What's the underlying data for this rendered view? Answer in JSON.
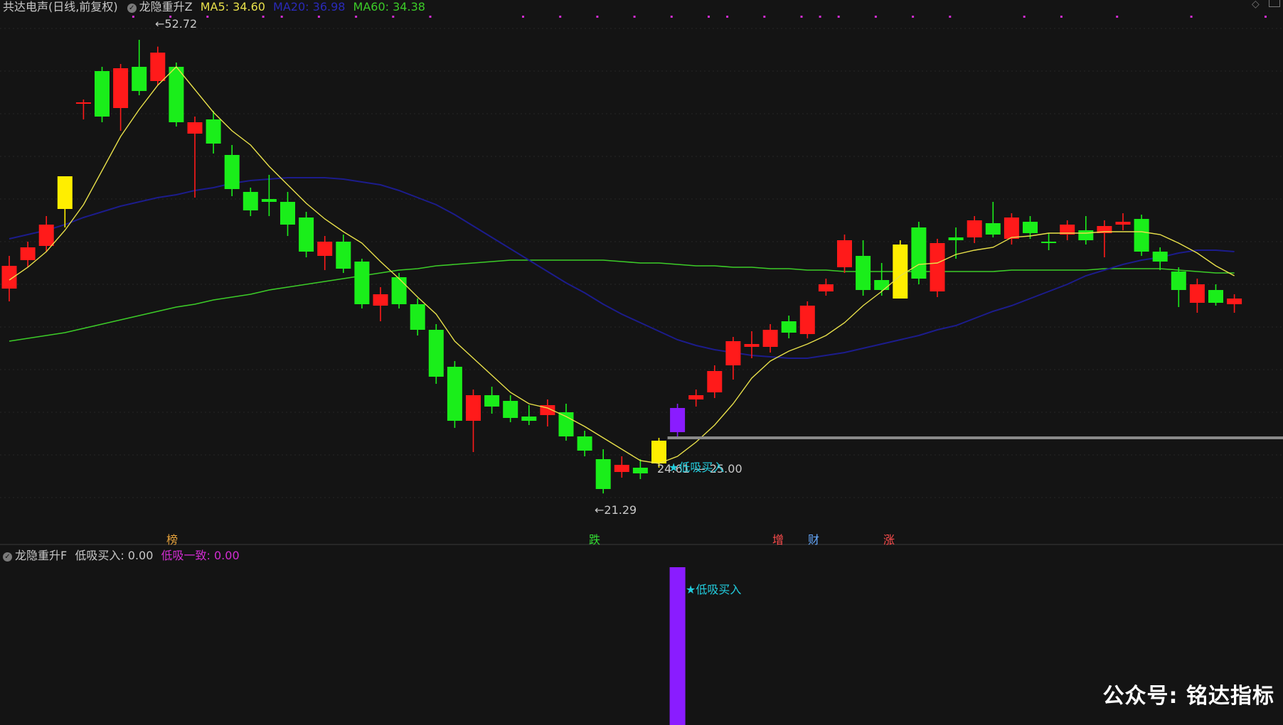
{
  "header": {
    "stock_title": "共达电声(日线,前复权)",
    "indicator_name": "龙隐重升Z",
    "ma5": "MA5: 34.60",
    "ma20": "MA20: 36.98",
    "ma60": "MA60: 34.38"
  },
  "sub_header": {
    "indicator_name": "龙隐重升F",
    "buy_label": "低吸买入: 0.00",
    "consistency_label": "低吸一致: 0.00"
  },
  "annotations": {
    "high_price": "52.72",
    "low_price": "21.29",
    "signal_price_low": "24.61",
    "signal_price_high": "25.00",
    "signal_text": "★低吸买入",
    "sub_signal_text": "★低吸买入"
  },
  "event_markers": [
    {
      "text": "榜",
      "color": "#e6a23c"
    },
    {
      "text": "跌",
      "color": "#33dd33"
    },
    {
      "text": "增",
      "color": "#ff4d4d"
    },
    {
      "text": "财",
      "color": "#66aaff"
    },
    {
      "text": "涨",
      "color": "#ff4d4d"
    }
  ],
  "watermark": "公众号: 铭达指标",
  "colors": {
    "up": "#ff1a1a",
    "down": "#1aee1a",
    "signal_yellow": "#ffee00",
    "signal_purple": "#8a1cff",
    "ma5": "#e8e04a",
    "ma20": "#1c1c8c",
    "ma60": "#3ccc28",
    "magenta": "#d22cd2",
    "cyan": "#22ccdd",
    "text": "#c8c8c8"
  },
  "chart_data": {
    "type": "candlestick",
    "ylim": [
      20,
      54
    ],
    "high_marker": 52.72,
    "low_marker": 21.29,
    "signal_line_level": 25.0,
    "candles": [
      {
        "o": 37.3,
        "c": 35.7,
        "h": 38.0,
        "l": 34.8,
        "k": "up"
      },
      {
        "o": 37.7,
        "c": 38.6,
        "h": 39.0,
        "l": 37.2,
        "k": "up"
      },
      {
        "o": 38.7,
        "c": 40.2,
        "h": 40.8,
        "l": 38.3,
        "k": "up"
      },
      {
        "o": 43.6,
        "c": 41.3,
        "h": 42.6,
        "l": 40.0,
        "k": "yellow"
      },
      {
        "o": 48.8,
        "c": 48.7,
        "h": 49.0,
        "l": 47.6,
        "k": "up"
      },
      {
        "o": 51.0,
        "c": 47.8,
        "h": 51.3,
        "l": 47.4,
        "k": "down"
      },
      {
        "o": 48.4,
        "c": 51.2,
        "h": 51.5,
        "l": 46.8,
        "k": "up"
      },
      {
        "o": 51.3,
        "c": 49.6,
        "h": 53.2,
        "l": 49.3,
        "k": "down"
      },
      {
        "o": 50.3,
        "c": 52.3,
        "h": 52.72,
        "l": 50.0,
        "k": "up"
      },
      {
        "o": 51.3,
        "c": 47.4,
        "h": 51.6,
        "l": 47.1,
        "k": "down"
      },
      {
        "o": 46.6,
        "c": 47.4,
        "h": 47.8,
        "l": 42.1,
        "k": "up"
      },
      {
        "o": 47.6,
        "c": 45.9,
        "h": 48.2,
        "l": 45.2,
        "k": "down"
      },
      {
        "o": 45.1,
        "c": 42.7,
        "h": 45.8,
        "l": 42.2,
        "k": "down"
      },
      {
        "o": 42.5,
        "c": 41.2,
        "h": 42.8,
        "l": 40.8,
        "k": "down"
      },
      {
        "o": 42.0,
        "c": 41.8,
        "h": 43.7,
        "l": 40.8,
        "k": "down"
      },
      {
        "o": 41.8,
        "c": 40.2,
        "h": 42.5,
        "l": 39.4,
        "k": "down"
      },
      {
        "o": 40.7,
        "c": 38.3,
        "h": 41.1,
        "l": 37.9,
        "k": "down"
      },
      {
        "o": 38.0,
        "c": 39.0,
        "h": 39.4,
        "l": 37.0,
        "k": "up"
      },
      {
        "o": 39.0,
        "c": 37.1,
        "h": 39.5,
        "l": 36.8,
        "k": "down"
      },
      {
        "o": 37.6,
        "c": 34.6,
        "h": 37.8,
        "l": 34.3,
        "k": "down"
      },
      {
        "o": 34.5,
        "c": 35.3,
        "h": 35.8,
        "l": 33.4,
        "k": "up"
      },
      {
        "o": 36.5,
        "c": 34.6,
        "h": 36.8,
        "l": 34.3,
        "k": "down"
      },
      {
        "o": 34.6,
        "c": 32.8,
        "h": 35.0,
        "l": 32.4,
        "k": "down"
      },
      {
        "o": 32.8,
        "c": 29.5,
        "h": 33.2,
        "l": 29.0,
        "k": "down"
      },
      {
        "o": 30.2,
        "c": 26.4,
        "h": 30.6,
        "l": 25.9,
        "k": "down"
      },
      {
        "o": 26.4,
        "c": 28.2,
        "h": 28.6,
        "l": 24.2,
        "k": "up"
      },
      {
        "o": 28.2,
        "c": 27.4,
        "h": 28.8,
        "l": 26.9,
        "k": "down"
      },
      {
        "o": 27.8,
        "c": 26.6,
        "h": 28.2,
        "l": 26.3,
        "k": "down"
      },
      {
        "o": 26.7,
        "c": 26.4,
        "h": 27.5,
        "l": 26.1,
        "k": "down"
      },
      {
        "o": 26.8,
        "c": 27.5,
        "h": 27.9,
        "l": 26.0,
        "k": "up"
      },
      {
        "o": 27.0,
        "c": 25.3,
        "h": 27.6,
        "l": 25.0,
        "k": "down"
      },
      {
        "o": 25.3,
        "c": 24.3,
        "h": 25.7,
        "l": 23.9,
        "k": "down"
      },
      {
        "o": 23.7,
        "c": 21.6,
        "h": 24.4,
        "l": 21.29,
        "k": "down"
      },
      {
        "o": 22.8,
        "c": 23.3,
        "h": 23.9,
        "l": 22.4,
        "k": "up"
      },
      {
        "o": 23.1,
        "c": 22.7,
        "h": 23.7,
        "l": 22.3,
        "k": "down"
      },
      {
        "o": 23.4,
        "c": 25.0,
        "h": 25.2,
        "l": 23.1,
        "k": "yellow"
      },
      {
        "o": 25.6,
        "c": 27.3,
        "h": 27.6,
        "l": 25.2,
        "k": "purple"
      },
      {
        "o": 27.9,
        "c": 28.2,
        "h": 28.6,
        "l": 27.4,
        "k": "up"
      },
      {
        "o": 28.4,
        "c": 29.9,
        "h": 30.3,
        "l": 28.0,
        "k": "up"
      },
      {
        "o": 30.3,
        "c": 32.0,
        "h": 32.3,
        "l": 29.3,
        "k": "up"
      },
      {
        "o": 31.6,
        "c": 31.8,
        "h": 32.7,
        "l": 30.8,
        "k": "up"
      },
      {
        "o": 31.6,
        "c": 32.8,
        "h": 33.2,
        "l": 31.2,
        "k": "up"
      },
      {
        "o": 33.4,
        "c": 32.6,
        "h": 33.8,
        "l": 32.2,
        "k": "down"
      },
      {
        "o": 32.5,
        "c": 34.5,
        "h": 34.8,
        "l": 32.2,
        "k": "up"
      },
      {
        "o": 35.5,
        "c": 36.0,
        "h": 36.4,
        "l": 35.2,
        "k": "up"
      },
      {
        "o": 37.2,
        "c": 39.1,
        "h": 39.5,
        "l": 36.8,
        "k": "up"
      },
      {
        "o": 38.0,
        "c": 35.6,
        "h": 39.1,
        "l": 35.2,
        "k": "down"
      },
      {
        "o": 36.3,
        "c": 35.6,
        "h": 37.5,
        "l": 35.2,
        "k": "down"
      },
      {
        "o": 35.0,
        "c": 38.8,
        "h": 39.1,
        "l": 35.0,
        "k": "yellow"
      },
      {
        "o": 40.0,
        "c": 36.4,
        "h": 40.4,
        "l": 36.0,
        "k": "down"
      },
      {
        "o": 35.5,
        "c": 38.9,
        "h": 39.2,
        "l": 35.1,
        "k": "up"
      },
      {
        "o": 39.1,
        "c": 39.3,
        "h": 40.0,
        "l": 37.8,
        "k": "down"
      },
      {
        "o": 39.3,
        "c": 40.5,
        "h": 40.8,
        "l": 38.9,
        "k": "up"
      },
      {
        "o": 40.3,
        "c": 39.5,
        "h": 41.8,
        "l": 39.3,
        "k": "down"
      },
      {
        "o": 40.7,
        "c": 39.2,
        "h": 41.0,
        "l": 38.8,
        "k": "up"
      },
      {
        "o": 40.4,
        "c": 39.6,
        "h": 40.8,
        "l": 39.2,
        "k": "down"
      },
      {
        "o": 38.9,
        "c": 39.0,
        "h": 39.6,
        "l": 38.4,
        "k": "down"
      },
      {
        "o": 39.5,
        "c": 40.2,
        "h": 40.5,
        "l": 39.1,
        "k": "up"
      },
      {
        "o": 39.8,
        "c": 39.1,
        "h": 40.8,
        "l": 38.8,
        "k": "down"
      },
      {
        "o": 39.6,
        "c": 40.1,
        "h": 40.5,
        "l": 37.9,
        "k": "up"
      },
      {
        "o": 40.2,
        "c": 40.4,
        "h": 41.0,
        "l": 39.8,
        "k": "up"
      },
      {
        "o": 40.6,
        "c": 38.3,
        "h": 40.9,
        "l": 38.0,
        "k": "down"
      },
      {
        "o": 38.3,
        "c": 37.6,
        "h": 38.6,
        "l": 37.0,
        "k": "down"
      },
      {
        "o": 36.9,
        "c": 35.6,
        "h": 37.2,
        "l": 34.4,
        "k": "down"
      },
      {
        "o": 36.0,
        "c": 34.7,
        "h": 36.4,
        "l": 34.0,
        "k": "up"
      },
      {
        "o": 35.6,
        "c": 34.7,
        "h": 36.0,
        "l": 34.5,
        "k": "down"
      },
      {
        "o": 35.0,
        "c": 34.6,
        "h": 35.3,
        "l": 34.0,
        "k": "up"
      }
    ],
    "ma20": [
      39.2,
      39.5,
      39.8,
      40.2,
      40.7,
      41.1,
      41.5,
      41.8,
      42.1,
      42.3,
      42.6,
      42.8,
      43.1,
      43.3,
      43.4,
      43.5,
      43.5,
      43.5,
      43.4,
      43.2,
      43.0,
      42.6,
      42.1,
      41.6,
      40.9,
      40.1,
      39.3,
      38.5,
      37.7,
      36.9,
      36.1,
      35.4,
      34.6,
      33.9,
      33.3,
      32.7,
      32.1,
      31.7,
      31.4,
      31.2,
      31.0,
      30.9,
      30.8,
      30.8,
      31.0,
      31.2,
      31.5,
      31.8,
      32.1,
      32.4,
      32.8,
      33.1,
      33.6,
      34.1,
      34.5,
      35.0,
      35.5,
      36.0,
      36.6,
      37.0,
      37.4,
      37.7,
      37.9,
      38.2,
      38.4,
      38.4,
      38.3
    ],
    "ma60": [
      32.0,
      32.2,
      32.4,
      32.6,
      32.9,
      33.2,
      33.5,
      33.8,
      34.1,
      34.4,
      34.6,
      34.9,
      35.1,
      35.3,
      35.6,
      35.8,
      36.0,
      36.2,
      36.4,
      36.6,
      36.8,
      37.0,
      37.1,
      37.3,
      37.4,
      37.5,
      37.6,
      37.7,
      37.7,
      37.7,
      37.7,
      37.7,
      37.7,
      37.6,
      37.5,
      37.5,
      37.4,
      37.3,
      37.3,
      37.2,
      37.2,
      37.1,
      37.1,
      37.0,
      37.0,
      36.9,
      36.9,
      36.9,
      36.9,
      36.9,
      36.9,
      36.9,
      36.9,
      36.9,
      37.0,
      37.0,
      37.0,
      37.0,
      37.0,
      37.1,
      37.1,
      37.1,
      37.1,
      37.0,
      36.9,
      36.8,
      36.8
    ],
    "ma5": [
      36.3,
      37.2,
      38.3,
      39.8,
      41.6,
      44.0,
      46.4,
      48.3,
      50.0,
      51.3,
      49.7,
      48.1,
      46.8,
      45.8,
      44.3,
      43.0,
      41.7,
      40.6,
      39.7,
      38.9,
      37.6,
      36.4,
      35.1,
      33.9,
      32.0,
      30.8,
      29.6,
      28.4,
      27.6,
      27.3,
      26.7,
      26.0,
      25.2,
      24.4,
      23.6,
      23.4,
      23.9,
      24.9,
      26.1,
      27.6,
      29.4,
      30.6,
      31.3,
      31.8,
      32.4,
      33.3,
      34.5,
      35.5,
      36.6,
      37.4,
      37.5,
      38.1,
      38.4,
      38.6,
      39.3,
      39.4,
      39.6,
      39.6,
      39.6,
      39.7,
      39.7,
      39.7,
      39.5,
      38.9,
      38.2,
      37.3,
      36.6
    ]
  }
}
